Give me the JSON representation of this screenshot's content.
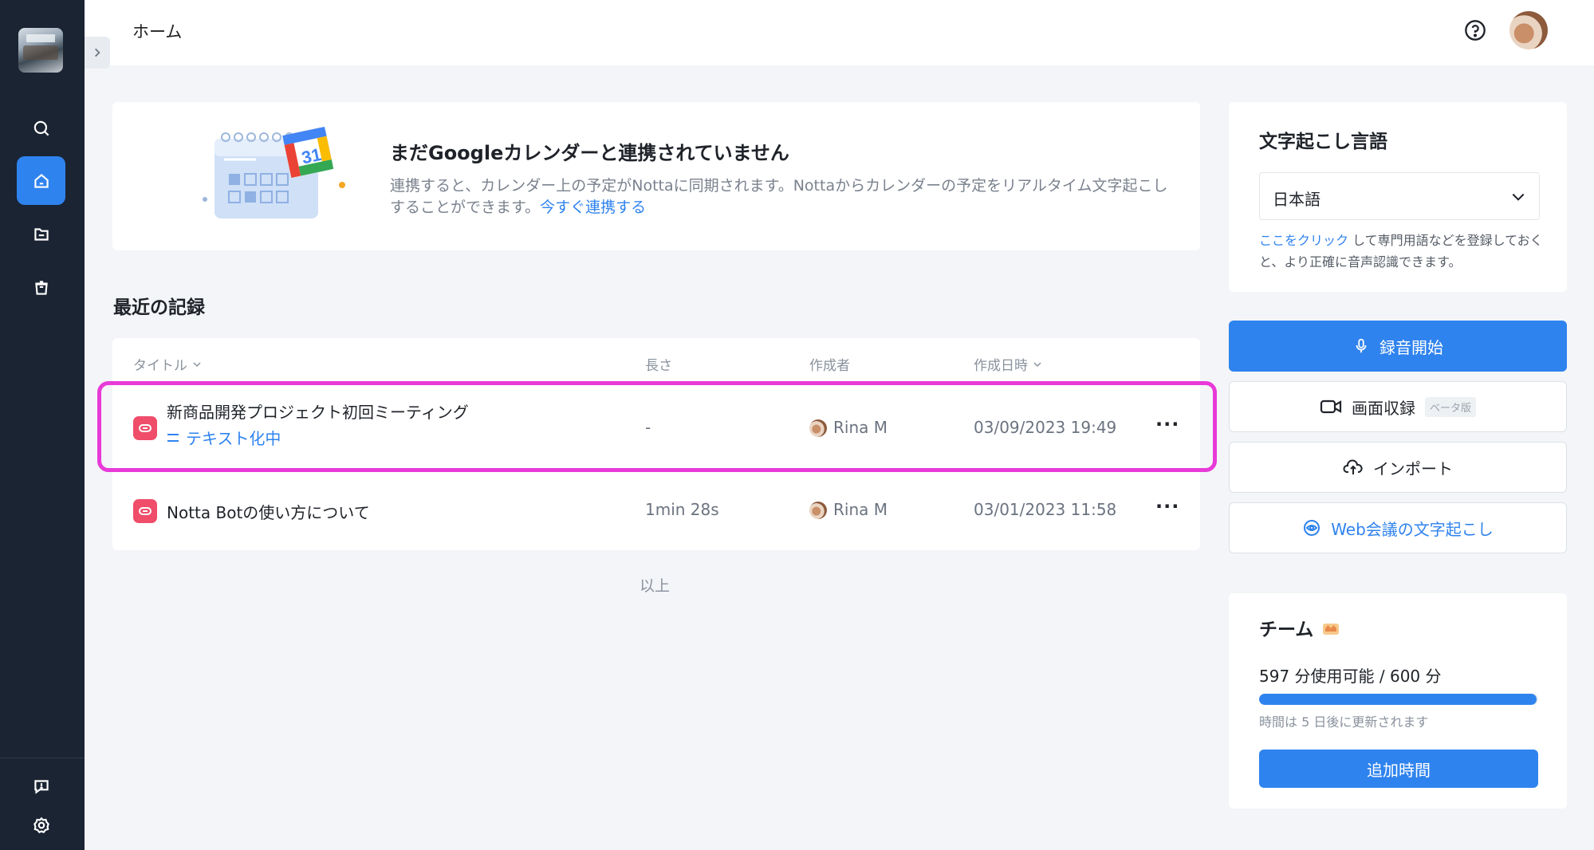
{
  "topbar": {
    "title": "ホーム"
  },
  "calendar_banner": {
    "title": "まだGoogleカレンダーと連携されていません",
    "description": "連携すると、カレンダー上の予定がNottaに同期されます。Nottaからカレンダーの予定をリアルタイム文字起こしすることができます。",
    "link": "今すぐ連携する",
    "calendar_number": "31"
  },
  "recent": {
    "title": "最近の記録",
    "headers": {
      "title": "タイトル",
      "length": "長さ",
      "creator": "作成者",
      "created_at": "作成日時"
    },
    "rows": [
      {
        "title": "新商品開発プロジェクト初回ミーティング",
        "status": "テキスト化中",
        "length": "-",
        "creator": "Rina M",
        "created_at": "03/09/2023 19:49",
        "more": "···"
      },
      {
        "title": "Notta Botの使い方について",
        "length": "1min 28s",
        "creator": "Rina M",
        "created_at": "03/01/2023 11:58",
        "more": "···"
      }
    ],
    "end_text": "以上"
  },
  "language": {
    "title": "文字起こし言語",
    "selected": "日本語",
    "note_link": "ここをクリック",
    "note_text": " して専門用語などを登録しておくと、より正確に音声認識できます。"
  },
  "actions": {
    "record": "録音開始",
    "screen_record": "画面収録",
    "beta": "ベータ版",
    "import": "インポート",
    "web_meeting": "Web会議の文字起こし"
  },
  "team": {
    "title": "チーム",
    "usage": "597 分使用可能 / 600 分",
    "usage_fraction": 0.995,
    "renew": "時間は 5 日後に更新されます",
    "add_time": "追加時間"
  },
  "colors": {
    "accent": "#2f83ee",
    "sidebar": "#1b2433",
    "highlight": "#e83ad8",
    "record_icon": "#ef4d6a"
  },
  "icons": [
    "search-icon",
    "home-icon",
    "folder-icon",
    "trash-icon",
    "feedback-icon",
    "settings-icon",
    "help-icon",
    "microphone-icon",
    "camera-icon",
    "upload-cloud-icon",
    "web-meeting-icon",
    "crown-icon",
    "chevron-down-icon",
    "chevron-right-icon"
  ]
}
